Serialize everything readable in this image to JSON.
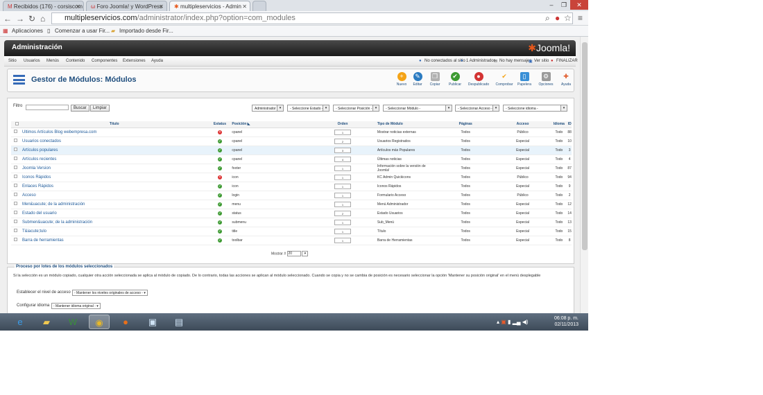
{
  "browser": {
    "tabs": [
      {
        "label": "Recibidos (176) - corsiscom",
        "icon": "gmail-icon"
      },
      {
        "label": "Foro Joomla! y WordPress",
        "icon": "wordpress-icon"
      },
      {
        "label": "multipleservicios - Admin",
        "icon": "joomla-icon"
      }
    ],
    "url_host": "multipleservicios.com",
    "url_path": "/administrator/index.php?option=com_modules",
    "bookmarks": [
      "Aplicaciones",
      "Comenzar a usar Fir...",
      "Importado desde Fir..."
    ]
  },
  "admin": {
    "title": "Administración",
    "logo": "Joomla!",
    "menu": [
      "Sitio",
      "Usuarios",
      "Menús",
      "Contenido",
      "Componentes",
      "Extensiones",
      "Ayuda"
    ],
    "status": [
      "No conectados al sitio",
      "1 Administrador",
      "No hay mensajes",
      "Ver sitio",
      "FINALIZAR"
    ]
  },
  "toolbar": {
    "title": "Gestor de Módulos: Módulos",
    "buttons": [
      {
        "label": "Nuevo",
        "color": "#f4a316",
        "icon": "plus-icon",
        "glyph": "+"
      },
      {
        "label": "Editar",
        "color": "#2b7bc1",
        "icon": "edit-icon",
        "glyph": "✎"
      },
      {
        "label": "Copiar",
        "color": "#b0b0b0",
        "icon": "copy-icon",
        "glyph": "❐"
      },
      {
        "label": "Publicar",
        "color": "#3d9a32",
        "icon": "check-icon",
        "glyph": "✔"
      },
      {
        "label": "Despublicado",
        "color": "#d33333",
        "icon": "stop-icon",
        "glyph": "●"
      },
      {
        "label": "Comprobar",
        "color": "#f4a316",
        "icon": "checkin-icon",
        "glyph": "✔"
      },
      {
        "label": "Papelera",
        "color": "#3a8fd6",
        "icon": "trash-icon",
        "glyph": "▯"
      },
      {
        "label": "Opciones",
        "color": "#9a9a9a",
        "icon": "options-icon",
        "glyph": "⚙"
      },
      {
        "label": "Ayuda",
        "color": "#e05a2a",
        "icon": "help-icon",
        "glyph": "✚"
      }
    ]
  },
  "filters": {
    "label": "Filtro",
    "search_btn": "Buscar",
    "clear_btn": "Limpiar",
    "selects": [
      "Administrador",
      "- Seleccione Estado -",
      "- Seleccionar Posición -",
      "- Seleccionar Módulo -",
      "- Seleccionar Acceso -",
      "- Seleccione idioma -"
    ]
  },
  "table": {
    "headers": [
      "Título",
      "Estatus",
      "Posición",
      "Orden",
      "Tipo de Módulo",
      "Páginas",
      "Acceso",
      "Idioma",
      "ID"
    ],
    "rows": [
      {
        "title": "Ultimos Artículos Blog webempresa.com",
        "published": false,
        "position": "cpanel",
        "order": "1",
        "type": "Mostrar noticias externas",
        "pages": "Todos",
        "access": "Público",
        "lang": "Todo",
        "id": "88"
      },
      {
        "title": "Usuarios conectados",
        "published": true,
        "position": "cpanel",
        "order": "2",
        "type": "Usuarios Registrados",
        "pages": "Todos",
        "access": "Especial",
        "lang": "Todo",
        "id": "10"
      },
      {
        "title": "Artículos populares",
        "published": true,
        "position": "cpanel",
        "order": "3",
        "type": "Artículos más Populares",
        "pages": "Todos",
        "access": "Especial",
        "lang": "Todo",
        "id": "3"
      },
      {
        "title": "Artículos recientes",
        "published": true,
        "position": "cpanel",
        "order": "4",
        "type": "Últimas noticias",
        "pages": "Todos",
        "access": "Especial",
        "lang": "Todo",
        "id": "4"
      },
      {
        "title": "Joomla Version",
        "published": true,
        "position": "footer",
        "order": "1",
        "type": "Información sobre la versión de Joomla!",
        "pages": "Todos",
        "access": "Especial",
        "lang": "Todo",
        "id": "87"
      },
      {
        "title": "Iconos Rápidos",
        "published": false,
        "position": "icon",
        "order": "1",
        "type": "KC Admin Quickicons",
        "pages": "Todos",
        "access": "Público",
        "lang": "Todo",
        "id": "94"
      },
      {
        "title": "Enlaces Rápidos",
        "published": true,
        "position": "icon",
        "order": "1",
        "type": "Iconos Rápidos",
        "pages": "Todos",
        "access": "Especial",
        "lang": "Todo",
        "id": "9"
      },
      {
        "title": "Acceso",
        "published": true,
        "position": "login",
        "order": "1",
        "type": "Formulario Acceso",
        "pages": "Todos",
        "access": "Público",
        "lang": "Todo",
        "id": "2"
      },
      {
        "title": "Men&uacute; de la administración",
        "published": true,
        "position": "menu",
        "order": "1",
        "type": "Menú Administrador",
        "pages": "Todos",
        "access": "Especial",
        "lang": "Todo",
        "id": "12"
      },
      {
        "title": "Estado del usuario",
        "published": true,
        "position": "status",
        "order": "2",
        "type": "Estado Usuarios",
        "pages": "Todos",
        "access": "Especial",
        "lang": "Todo",
        "id": "14"
      },
      {
        "title": "Submen&uacute; de la administración",
        "published": true,
        "position": "submenu",
        "order": "1",
        "type": "Sub_Menú",
        "pages": "Todos",
        "access": "Especial",
        "lang": "Todo",
        "id": "13"
      },
      {
        "title": "T&iacute;tulo",
        "published": true,
        "position": "title",
        "order": "1",
        "type": "Título",
        "pages": "Todos",
        "access": "Especial",
        "lang": "Todo",
        "id": "15"
      },
      {
        "title": "Barra de herramientas",
        "published": true,
        "position": "toolbar",
        "order": "1",
        "type": "Barra de Herramientas",
        "pages": "Todos",
        "access": "Especial",
        "lang": "Todo",
        "id": "8"
      }
    ],
    "display_label": "Mostrar #",
    "display_value": "20"
  },
  "batch": {
    "legend": "Proceso por lotes de los módulos seleccionados",
    "description": "Si la selección es un módulo copiado, cualquier otra acción seleccionada se aplica al módulo de copiado. De lo contrario, todas las acciones se aplican al módulo seleccionado. Cuando se copia y no se cambia de posición es necesario seleccionar la opción 'Mantener su posición original' en el menú desplegable",
    "access_label": "Establecer el nivel de acceso",
    "access_value": "- Mantener los niveles originales de acceso -",
    "lang_label": "Configurar idioma",
    "lang_value": "- Mantener idioma original -"
  },
  "taskbar": {
    "apps": [
      "ie-icon",
      "explorer-icon",
      "word-icon",
      "chrome-icon",
      "firefox-icon",
      "computer-icon",
      "notepad-icon"
    ],
    "time": "06:08 p. m.",
    "date": "02/11/2013"
  }
}
